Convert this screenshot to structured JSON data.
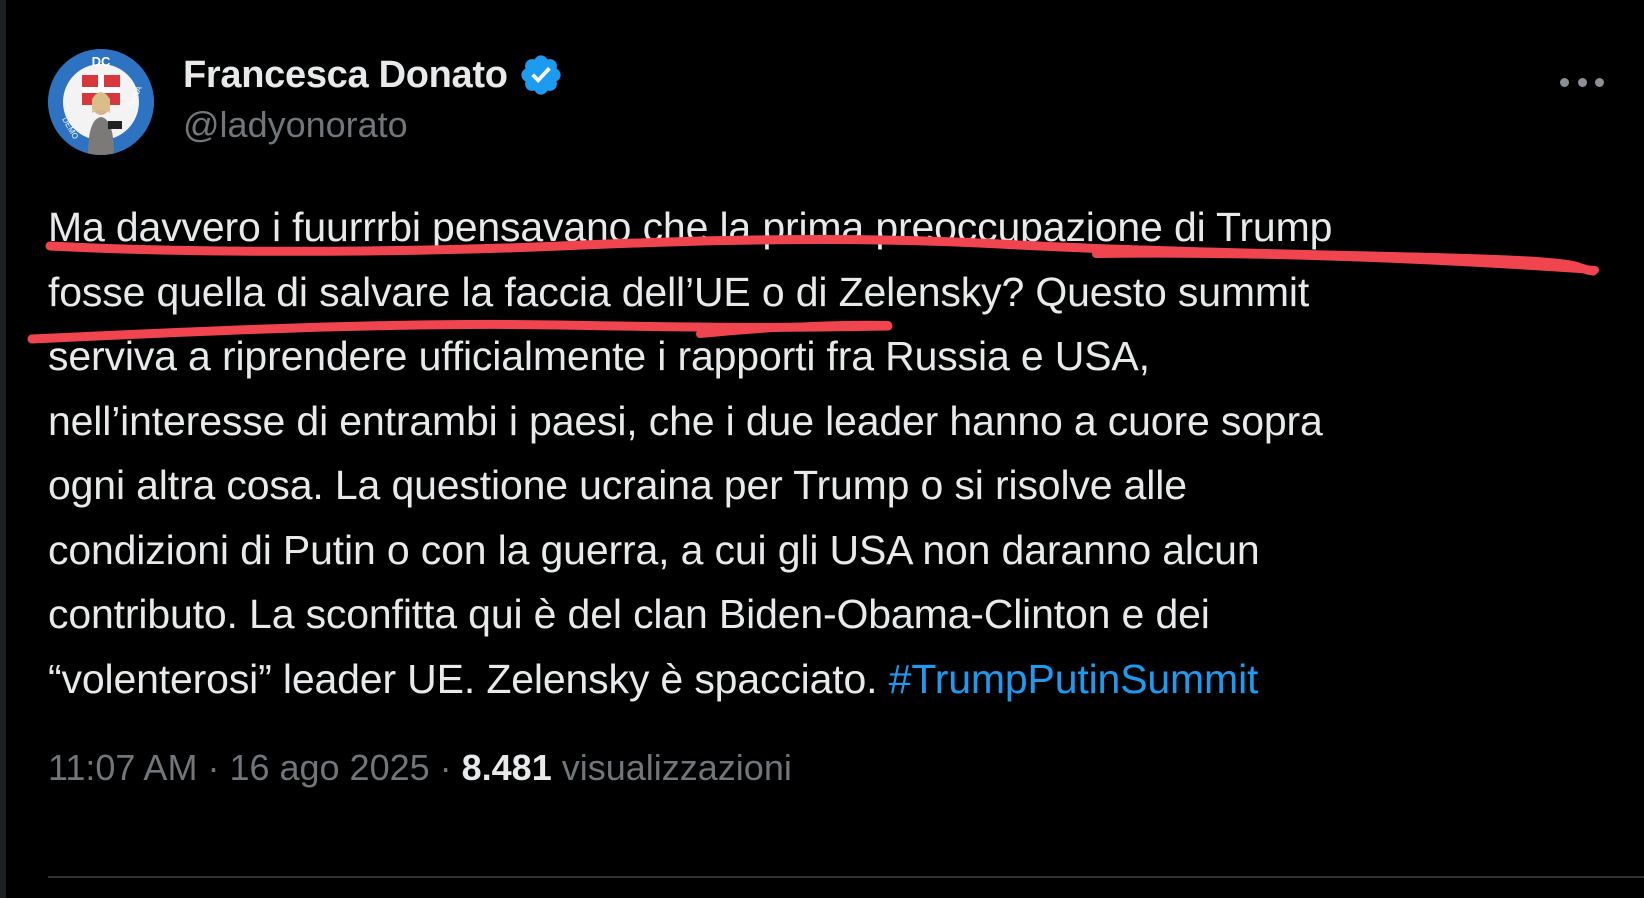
{
  "author": {
    "display_name": "Francesca Donato",
    "handle": "@ladyonorato",
    "verified": true,
    "avatar_logo_text": "DC",
    "avatar_ring_text_left": "DEMO",
    "avatar_ring_text_right": "TIANA"
  },
  "tweet": {
    "text_lines": [
      "Ma davvero i fuurrrbi pensavano che la prima preoccupazione di Trump",
      "fosse quella di salvare la faccia dell’UE o di Zelensky? Questo summit",
      "serviva a riprendere ufficialmente i rapporti fra Russia e USA,",
      "nell’interesse di entrambi i paesi, che i due leader hanno a cuore sopra",
      "ogni altra cosa. La questione ucraina per Trump o si risolve alle",
      "condizioni di Putin o con la guerra, a cui gli USA non daranno alcun",
      "contributo. La sconfitta qui è del clan Biden-Obama-Clinton e dei",
      "“volenterosi” leader UE. Zelensky è spacciato. "
    ],
    "hashtag": "#TrumpPutinSummit"
  },
  "meta": {
    "time": "11:07 AM",
    "separator": " · ",
    "date": "16 ago 2025",
    "separator2": " · ",
    "views_count": "8.481",
    "views_label": " visualizzazioni"
  },
  "colors": {
    "background": "#000000",
    "text": "#e7e9ea",
    "secondary": "#71767b",
    "accent": "#1d9bf0",
    "annotation_underline": "#f0454e"
  },
  "icons": {
    "verified": "verified-badge-icon",
    "more": "more-options-icon"
  }
}
